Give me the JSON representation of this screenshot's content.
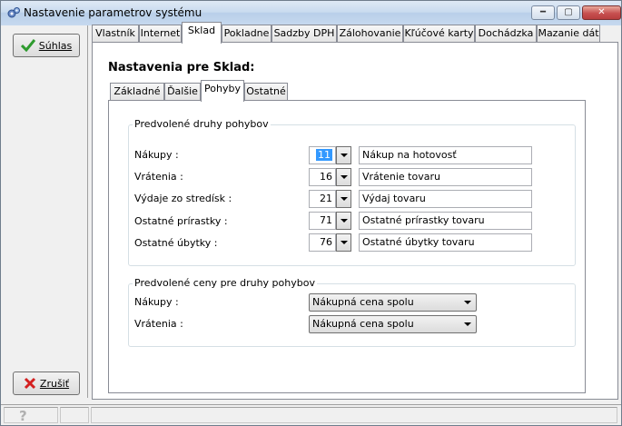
{
  "window": {
    "title": "Nastavenie parametrov systému",
    "minimize_icon": "minimize-icon",
    "maximize_icon": "maximize-icon",
    "close_icon": "close-icon"
  },
  "left_panel": {
    "ok_button": {
      "label": "Súhlas",
      "icon": "checkmark-icon"
    },
    "cancel_button": {
      "label": "Zrušiť",
      "icon": "red-x-icon"
    }
  },
  "main_tabs": [
    "Vlastník",
    "Internet",
    "Sklad",
    "Pokladne",
    "Sadzby DPH",
    "Zálohovanie",
    "Kľúčové karty",
    "Dochádzka",
    "Mazanie dát"
  ],
  "main_active_tab": "Sklad",
  "heading": "Nastavenia pre Sklad:",
  "sub_tabs": [
    "Základné",
    "Ďalšie",
    "Pohyby",
    "Ostatné"
  ],
  "sub_active_tab": "Pohyby",
  "movements_group": {
    "title": "Predvolené druhy pohybov",
    "rows": [
      {
        "label": "Nákupy :",
        "code": "11",
        "name": "Nákup na hotovosť"
      },
      {
        "label": "Vrátenia :",
        "code": "16",
        "name": "Vrátenie tovaru"
      },
      {
        "label": "Výdaje zo stredísk :",
        "code": "21",
        "name": "Výdaj tovaru"
      },
      {
        "label": "Ostatné prírastky :",
        "code": "71",
        "name": "Ostatné prírastky tovaru"
      },
      {
        "label": "Ostatné úbytky :",
        "code": "76",
        "name": "Ostatné úbytky tovaru"
      }
    ]
  },
  "prices_group": {
    "title": "Predvolené ceny pre druhy pohybov",
    "rows": [
      {
        "label": "Nákupy :",
        "value": "Nákupná cena spolu"
      },
      {
        "label": "Vrátenia :",
        "value": "Nákupná cena spolu"
      }
    ]
  },
  "status_bar": {
    "help_icon": "help-icon"
  },
  "colors": {
    "selection": "#3399ff",
    "close_button": "#c75050",
    "tab_border": "#898c95"
  }
}
